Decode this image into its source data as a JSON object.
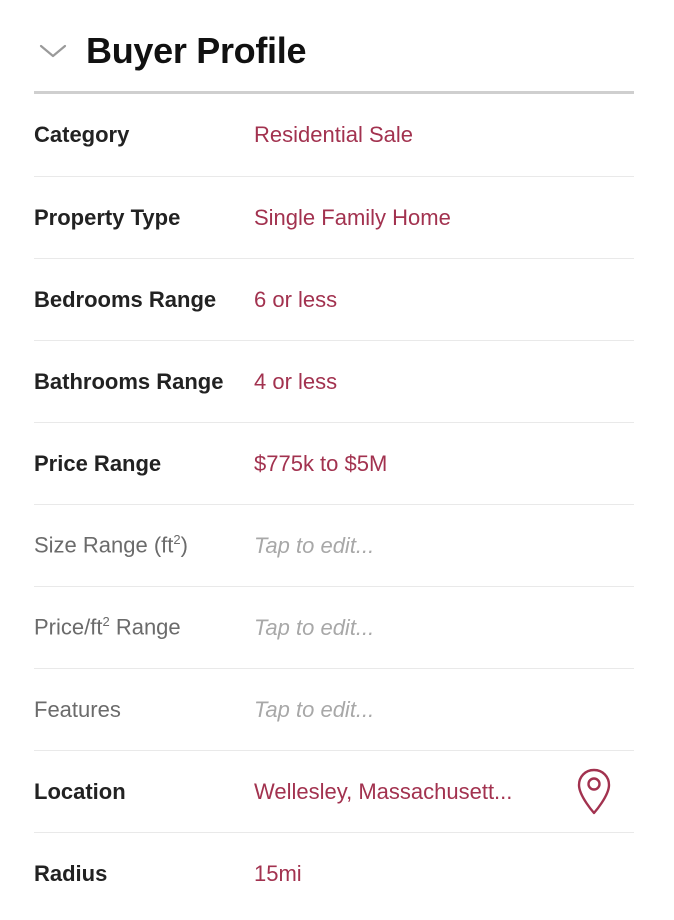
{
  "header": {
    "title": "Buyer Profile",
    "collapse_icon": "chevron-down-icon"
  },
  "rows": [
    {
      "label": "Category",
      "value": "Residential Sale"
    },
    {
      "label": "Property Type",
      "value": "Single Family Home"
    },
    {
      "label": "Bedrooms Range",
      "value": "6 or less"
    },
    {
      "label": "Bathrooms Range",
      "value": "4 or less"
    },
    {
      "label": "Price Range",
      "value": "$775k to $5M"
    },
    {
      "label_prefix": "Size Range (ft",
      "label_sup": "2",
      "label_suffix": ")",
      "value": "Tap to edit..."
    },
    {
      "label_prefix": "Price/ft",
      "label_sup": "2",
      "label_suffix": " Range",
      "value": "Tap to edit..."
    },
    {
      "label": "Features",
      "value": "Tap to edit..."
    },
    {
      "label": "Location",
      "value": "Wellesley, Massachusett...",
      "icon": "map-pin-icon"
    },
    {
      "label": "Radius",
      "value": "15mi"
    }
  ],
  "colors": {
    "accent": "#a2324f",
    "label_dark": "#222222",
    "label_light": "#6b6b6b",
    "placeholder": "#a8a8a8",
    "divider": "#e9e9e9",
    "header_rule": "#cfcfcf"
  }
}
